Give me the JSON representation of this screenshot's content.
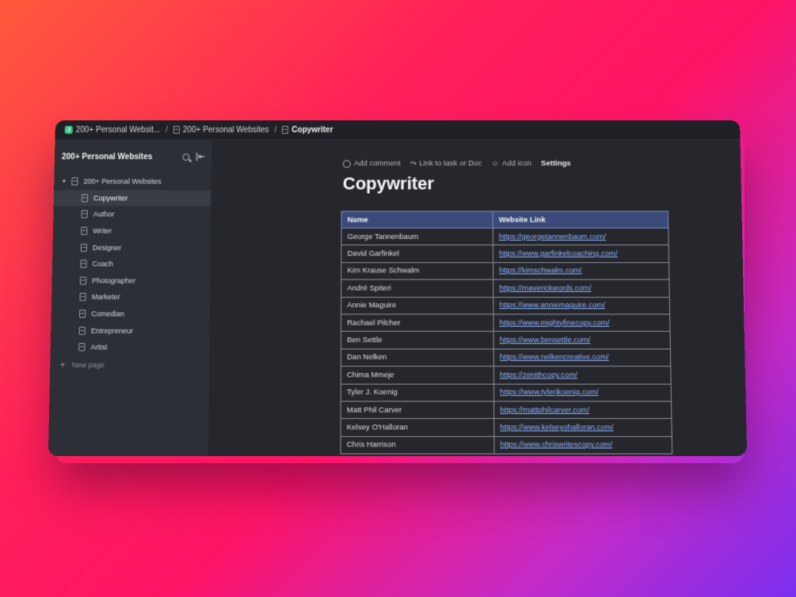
{
  "breadcrumbs": [
    {
      "label": "200+ Personal Websit...",
      "badge": "J"
    },
    {
      "label": "200+ Personal Websites"
    },
    {
      "label": "Copywriter"
    }
  ],
  "sidebar": {
    "title": "200+ Personal Websites",
    "root": "200+ Personal Websites",
    "items": [
      "Copywriter",
      "Author",
      "Writer",
      "Designer",
      "Coach",
      "Photographer",
      "Marketer",
      "Comedian",
      "Entrepreneur",
      "Artist"
    ],
    "new_page": "New page"
  },
  "toolbar": {
    "comment": "Add comment",
    "link": "Link to task or Doc",
    "icon": "Add icon",
    "settings": "Settings"
  },
  "page": {
    "title": "Copywriter"
  },
  "table": {
    "headers": [
      "Name",
      "Website Link"
    ],
    "rows": [
      [
        "George Tannenbaum",
        "https://georgetannenbaum.com/"
      ],
      [
        "David Garfinkel",
        "https://www.garfinkelcoaching.com/"
      ],
      [
        "Kim Krause Schwalm",
        "https://kimschwalm.com/"
      ],
      [
        "André Spiteri",
        "https://maverickwords.com/"
      ],
      [
        "Annie Maguire",
        "https://www.anniemaguire.com/"
      ],
      [
        "Rachael Pilcher",
        "https://www.mightyfinecopy.com/"
      ],
      [
        "Ben Settle",
        "https://www.bensettle.com/"
      ],
      [
        "Dan Nelken",
        "https://www.nelkencreative.com/"
      ],
      [
        "Chima Mmeje",
        "https://zenithcopy.com/"
      ],
      [
        "Tyler J. Koenig",
        "https://www.tylerjkoenig.com/"
      ],
      [
        "Matt Phil Carver",
        "https://mattphilcarver.com/"
      ],
      [
        "Kelsey O'Halloran",
        "https://www.kelseyohalloran.com/"
      ],
      [
        "Chris Harrison",
        "https://www.chriswritescopy.com/"
      ]
    ]
  }
}
